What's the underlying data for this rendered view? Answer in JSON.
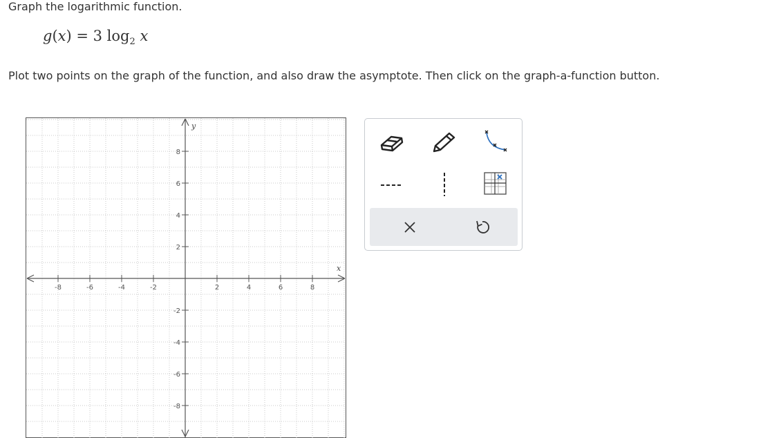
{
  "header": {
    "title": "Graph the logarithmic function."
  },
  "formula": {
    "lhs": "g",
    "arg": "x",
    "eq": " = 3 log",
    "base": "2",
    "var": "x"
  },
  "instruction": "Plot two points on the graph of the function, and also draw the asymptote. Then click on the graph-a-function button.",
  "graph": {
    "x_axis_label": "x",
    "y_axis_label": "y",
    "x_ticks": [
      "-8",
      "-6",
      "-4",
      "-2",
      "2",
      "4",
      "6",
      "8"
    ],
    "y_ticks": [
      "8",
      "6",
      "4",
      "2",
      "-2",
      "-4",
      "-6",
      "-8"
    ]
  },
  "toolbar": {
    "tools": [
      "eraser-tool",
      "pencil-tool",
      "graph-function-tool",
      "horizontal-asymptote-tool",
      "vertical-asymptote-tool",
      "asymptote-grid-tool"
    ],
    "actions": [
      "clear-x",
      "undo"
    ]
  }
}
